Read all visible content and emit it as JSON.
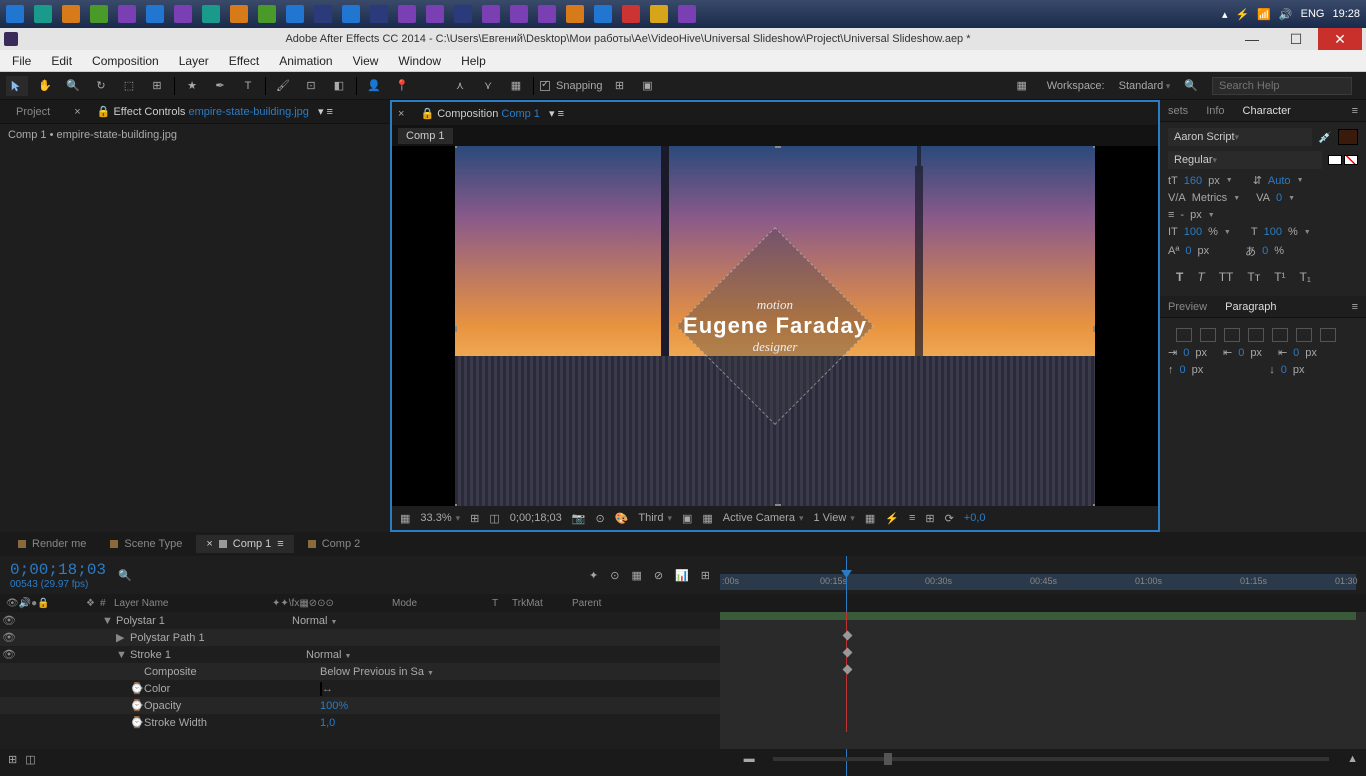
{
  "taskbar": {
    "lang": "ENG",
    "time": "19:28"
  },
  "titlebar": {
    "title": "Adobe After Effects CC 2014 - C:\\Users\\Евгений\\Desktop\\Мои работы\\Ae\\VideoHive\\Universal Slideshow\\Project\\Universal Slideshow.aep *"
  },
  "menu": {
    "file": "File",
    "edit": "Edit",
    "composition": "Composition",
    "layer": "Layer",
    "effect": "Effect",
    "animation": "Animation",
    "view": "View",
    "window": "Window",
    "help": "Help"
  },
  "toolbar": {
    "snapping": "Snapping",
    "workspace_lbl": "Workspace:",
    "workspace_val": "Standard",
    "search_ph": "Search Help"
  },
  "left": {
    "project_tab": "Project",
    "fx_tab": "Effect Controls",
    "fx_file": "empire-state-building.jpg",
    "breadcrumb": "Comp 1 • empire-state-building.jpg"
  },
  "center": {
    "comp_tab": "Composition",
    "comp_name": "Comp 1",
    "comp_active": "Comp 1",
    "preview_text1": "motion",
    "preview_text2": "Eugene Faraday",
    "preview_text3": "designer",
    "zoom": "33.3%",
    "timecode": "0;00;18;03",
    "res": "Third",
    "camera": "Active Camera",
    "view": "1 View",
    "exposure": "+0,0"
  },
  "right": {
    "tabs": {
      "presets": "sets",
      "info": "Info",
      "character": "Character"
    },
    "font": "Aaron Script",
    "style": "Regular",
    "size": "160",
    "size_unit": "px",
    "leading": "Auto",
    "kerning": "Metrics",
    "tracking": "0",
    "none_unit": "px",
    "hscale": "100",
    "vscale": "100",
    "pct": "%",
    "baseline": "0",
    "baseline_unit": "px",
    "tsume": "0",
    "tsume_pct": "%",
    "para_tabs": {
      "preview": "Preview",
      "paragraph": "Paragraph"
    },
    "indent0": "0",
    "indent_unit": "px"
  },
  "timeline": {
    "tabs": {
      "render": "Render me",
      "scene": "Scene Type",
      "comp1": "Comp 1",
      "comp2": "Comp 2"
    },
    "timecode": "0;00;18;03",
    "frame_info": "00543 (29.97 fps)",
    "cols": {
      "num": "#",
      "layername": "Layer Name",
      "mode": "Mode",
      "trkmat": "TrkMat",
      "parent": "Parent",
      "t": "T"
    },
    "ruler": {
      "m0": ":00s",
      "m15": "00:15s",
      "m30": "00:30s",
      "m45": "00:45s",
      "m60": "01:00s",
      "m75": "01:15s",
      "m90": "01:30"
    },
    "rows": [
      {
        "name": "Polystar 1",
        "mode": "Normal",
        "indent": 1,
        "tw": "▼"
      },
      {
        "name": "Polystar Path 1",
        "mode": "",
        "indent": 2,
        "tw": "▶"
      },
      {
        "name": "Stroke 1",
        "mode": "Normal",
        "indent": 2,
        "tw": "▼"
      },
      {
        "name": "Composite",
        "mode": "Below Previous in Sa",
        "indent": 3,
        "tw": ""
      },
      {
        "name": "Color",
        "mode": "",
        "indent": 3,
        "tw": "⌚",
        "swatch": true
      },
      {
        "name": "Opacity",
        "mode": "100%",
        "indent": 3,
        "tw": "⌚",
        "blue": true
      },
      {
        "name": "Stroke Width",
        "mode": "1,0",
        "indent": 3,
        "tw": "⌚",
        "blue": true
      }
    ]
  }
}
